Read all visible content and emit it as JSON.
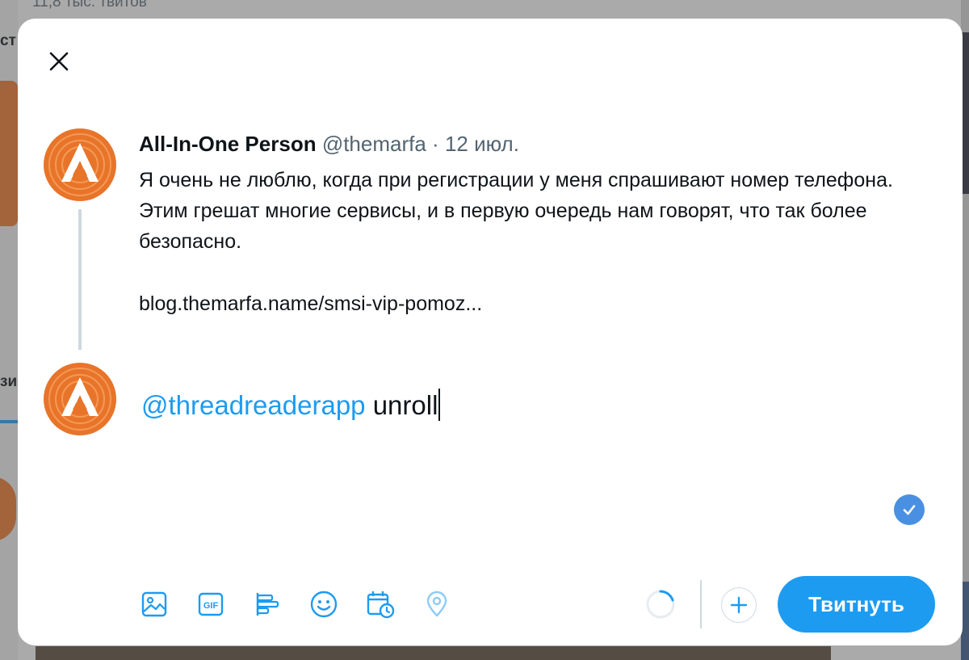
{
  "background": {
    "tweet_count": "11,8 тыс. твитов",
    "left_text_1": "ст",
    "left_text_2": "зи"
  },
  "modal": {
    "close_icon": "close-icon"
  },
  "thread": {
    "author_name": "All-In-One Person",
    "author_handle": "@themarfa",
    "separator": "·",
    "date": "12 июл.",
    "body": "Я очень не люблю, когда при регистрации у меня спрашивают номер телефона. Этим грешат многие сервисы, и в первую очередь нам говорят, что так более безопасно.",
    "link": "blog.themarfa.name/smsi-vip-pomoz..."
  },
  "compose": {
    "mention": "@threadreaderapp",
    "text": " unroll"
  },
  "toolbar": {
    "icons": [
      "image-icon",
      "gif-icon",
      "poll-icon",
      "emoji-icon",
      "schedule-icon",
      "location-icon"
    ],
    "submit_label": "Твитнуть"
  },
  "colors": {
    "accent": "#1d9bf0",
    "avatar": "#e8742a",
    "text": "#0f1419",
    "muted": "#536471"
  }
}
